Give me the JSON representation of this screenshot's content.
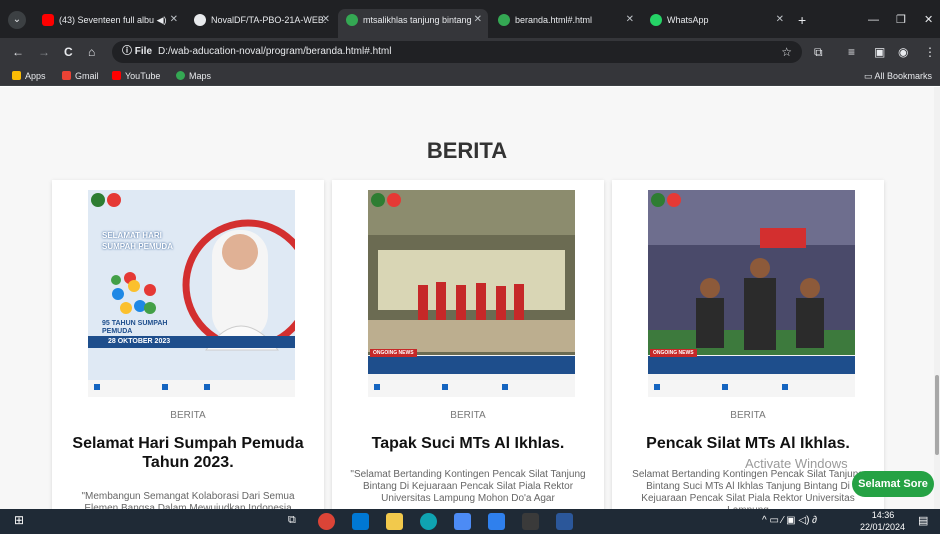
{
  "tabs": [
    {
      "title": "(43) Seventeen full albu",
      "audio_icon": "speaker-icon",
      "color": "#ff0000"
    },
    {
      "title": "NovalDF/TA-PBO-21A-WEB.",
      "color": "#e8eaed"
    },
    {
      "title": "mtsalikhlas tanjung bintang",
      "color": "#34a853"
    },
    {
      "title": "beranda.html#.html",
      "color": "#34a853"
    },
    {
      "title": "WhatsApp",
      "color": "#25d366"
    }
  ],
  "toolbar": {
    "back": "←",
    "forward": "→",
    "reload": "C",
    "home": "⌂",
    "file_chip": "ⓘ File",
    "url": "D:/wab-aducation-noval/program/beranda.html#.html",
    "star": "☆"
  },
  "bookmarks": {
    "items": [
      {
        "label": "Apps",
        "color": "#fbbc05"
      },
      {
        "label": "Gmail",
        "color": "#ea4335"
      },
      {
        "label": "YouTube",
        "color": "#ff0000"
      },
      {
        "label": "Maps",
        "color": "#34a853"
      }
    ],
    "all_bookmarks": "All Bookmarks"
  },
  "page": {
    "section_title": "BERITA",
    "cards": [
      {
        "category": "BERITA",
        "title": "Selamat Hari Sumpah Pemuda Tahun 2023.",
        "desc": "\"Membangun Semangat Kolaborasi Dari Semua Elemen Bangsa Dalam Mewujudkan Indonesia",
        "poster_title": "SELAMAT HARI SUMPAH PEMUDA",
        "poster_sub": "95 TAHUN SUMPAH PEMUDA",
        "poster_date": "28 OKTOBER 2023"
      },
      {
        "category": "BERITA",
        "title": "Tapak Suci MTs Al Ikhlas.",
        "desc": "\"Selamat Bertanding Kontingen Pencak Silat Tanjung Bintang Di Kejuaraan Pencak Silat Piala Rektor Universitas Lampung Mohon Do'a Agar",
        "poster_badge": "ONGOING NEWS"
      },
      {
        "category": "BERITA",
        "title": "Pencak Silat MTs Al Ikhlas.",
        "desc": "Selamat Bertanding Kontingen Pencak Silat Tanjung Bintang Suci MTs Al Ikhlas Tanjung Bintang Di Kejuaraan Pencak Silat Piala Rektor Universitas Lampung",
        "poster_badge": "ONGOING NEWS"
      }
    ]
  },
  "overlay": {
    "activate_windows": "Activate Windows",
    "greeting_button": "Selamat Sore"
  },
  "taskbar": {
    "time": "14:36",
    "date": "22/01/2024",
    "tray": "^ ▭ ⁄ ▣ ◁) ∂"
  }
}
